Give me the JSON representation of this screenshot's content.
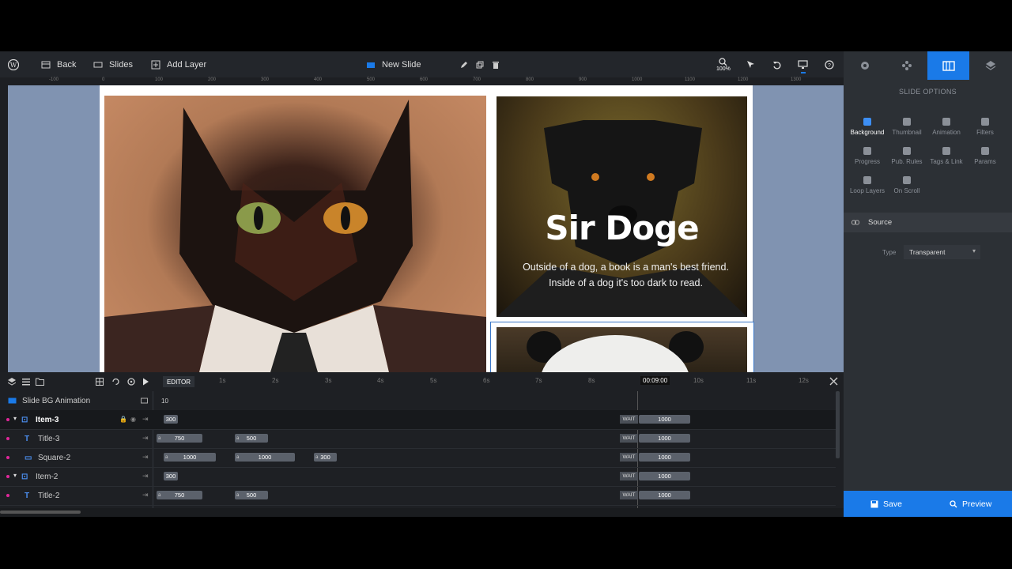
{
  "toolbar": {
    "back": "Back",
    "slides": "Slides",
    "add_layer": "Add Layer",
    "slide_name": "New Slide",
    "zoom": "100%"
  },
  "ruler": {
    "labels": [
      "-100",
      "0",
      "100",
      "200",
      "300",
      "400",
      "500",
      "600",
      "700",
      "800",
      "900",
      "1000",
      "1100",
      "1200",
      "1300"
    ]
  },
  "slide": {
    "title": "Sir Doge",
    "text": "Outside of a dog, a book is a man's best friend. Inside of a dog it's too dark to read."
  },
  "right_panel": {
    "heading": "SLIDE OPTIONS",
    "options": [
      {
        "label": "Background",
        "active": true
      },
      {
        "label": "Thumbnail",
        "active": false
      },
      {
        "label": "Animation",
        "active": false
      },
      {
        "label": "Filters",
        "active": false
      },
      {
        "label": "Progress",
        "active": false
      },
      {
        "label": "Pub. Rules",
        "active": false
      },
      {
        "label": "Tags & Link",
        "active": false
      },
      {
        "label": "Params",
        "active": false
      },
      {
        "label": "Loop Layers",
        "active": false
      },
      {
        "label": "On Scroll",
        "active": false
      }
    ],
    "source_label": "Source",
    "type_label": "Type",
    "type_value": "Transparent",
    "save": "Save",
    "preview": "Preview"
  },
  "timeline": {
    "editor_tab": "EDITOR",
    "time_labels": [
      "1s",
      "2s",
      "3s",
      "4s",
      "5s",
      "6s",
      "7s",
      "8s",
      "00:09:00",
      "10s",
      "11s",
      "12s"
    ],
    "bg_row": {
      "label": "Slide BG Animation",
      "value": "10"
    },
    "rows": [
      {
        "label": "Item-3",
        "bars": [
          {
            "v": "300"
          }
        ],
        "wait": "WAIT",
        "end": "1000"
      },
      {
        "label": "Title-3",
        "bars": [
          {
            "v": "750"
          },
          {
            "v": "500"
          }
        ],
        "wait": "WAIT",
        "end": "1000"
      },
      {
        "label": "Square-2",
        "bars": [
          {
            "v": "1000"
          },
          {
            "v": "1000"
          },
          {
            "v": "300"
          }
        ],
        "wait": "WAIT",
        "end": "1000"
      },
      {
        "label": "Item-2",
        "bars": [
          {
            "v": "300"
          }
        ],
        "wait": "WAIT",
        "end": "1000"
      },
      {
        "label": "Title-2",
        "bars": [
          {
            "v": "750"
          },
          {
            "v": "500"
          }
        ],
        "wait": "WAIT",
        "end": "1000"
      }
    ]
  },
  "colors": {
    "accent": "#1a7ae8",
    "pink": "#e0279a"
  }
}
